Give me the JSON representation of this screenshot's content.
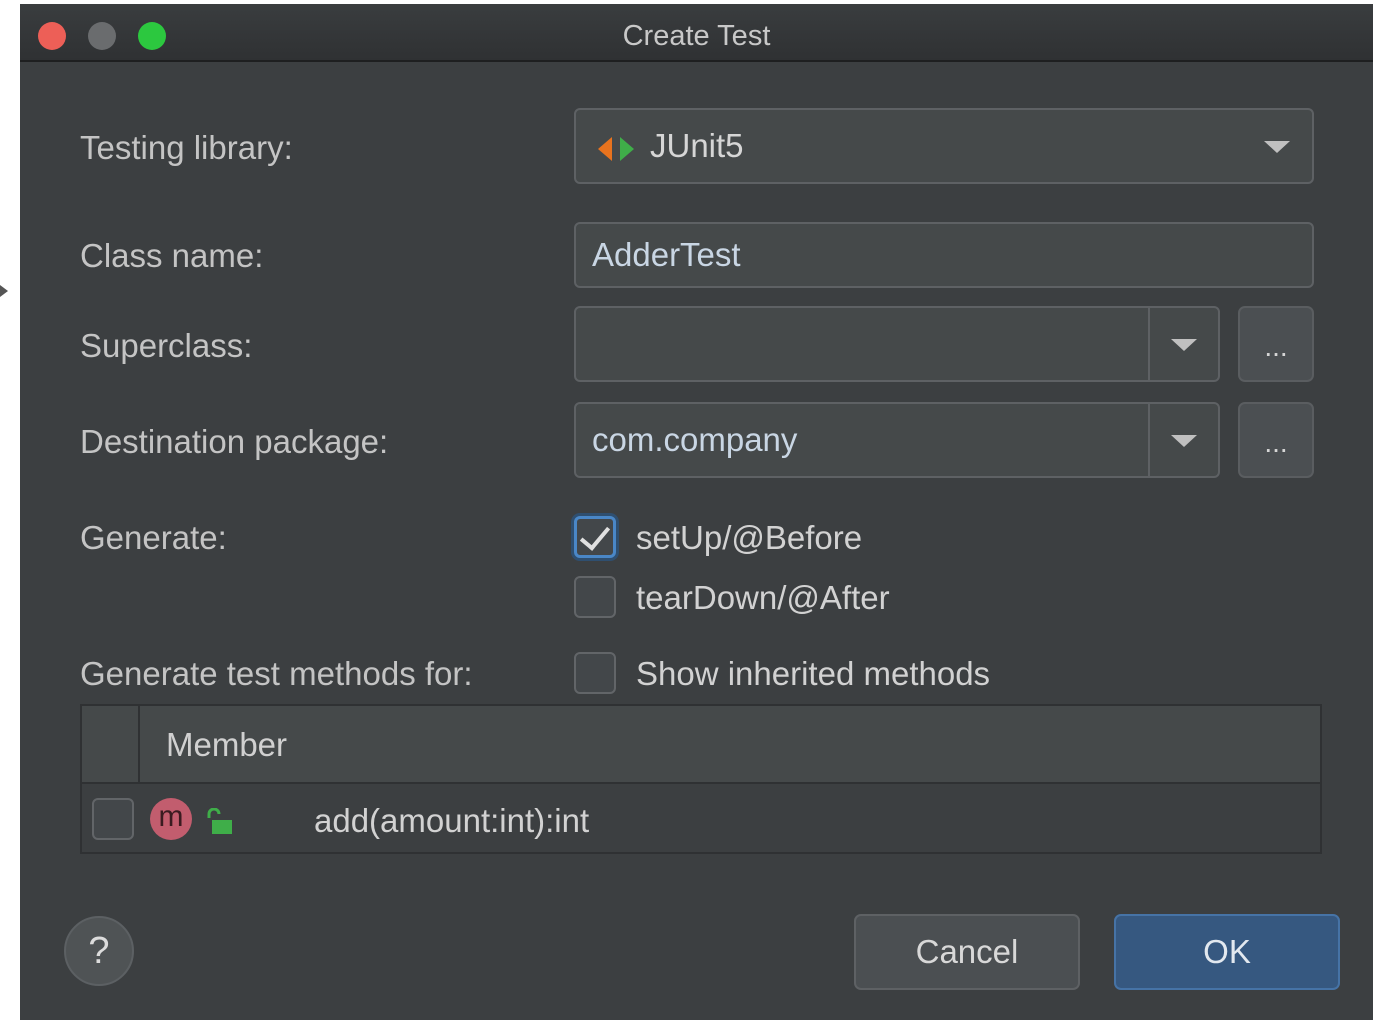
{
  "window": {
    "title": "Create Test"
  },
  "form": {
    "testing_library": {
      "label": "Testing library:",
      "value": "JUnit5"
    },
    "class_name": {
      "label": "Class name:",
      "value": "AdderTest"
    },
    "superclass": {
      "label": "Superclass:",
      "value": "",
      "browse_label": "..."
    },
    "destination_package": {
      "label": "Destination package:",
      "value": "com.company",
      "browse_label": "..."
    },
    "generate": {
      "label": "Generate:",
      "options": [
        {
          "label": "setUp/@Before",
          "checked": true
        },
        {
          "label": "tearDown/@After",
          "checked": false
        }
      ]
    },
    "methods": {
      "label": "Generate test methods for:",
      "show_inherited": {
        "label": "Show inherited methods",
        "checked": false
      }
    }
  },
  "table": {
    "columns": [
      "",
      "Member"
    ],
    "rows": [
      {
        "checked": false,
        "icon": "method-icon",
        "visibility_icon": "public-unlock-icon",
        "member": "add(amount:int):int"
      }
    ]
  },
  "buttons": {
    "help": "?",
    "cancel": "Cancel",
    "ok": "OK"
  },
  "colors": {
    "background": "#3c3f41",
    "accent": "#365880",
    "method_icon": "#c25d6e",
    "junit_orange": "#e8731e",
    "junit_green": "#3fae49"
  }
}
